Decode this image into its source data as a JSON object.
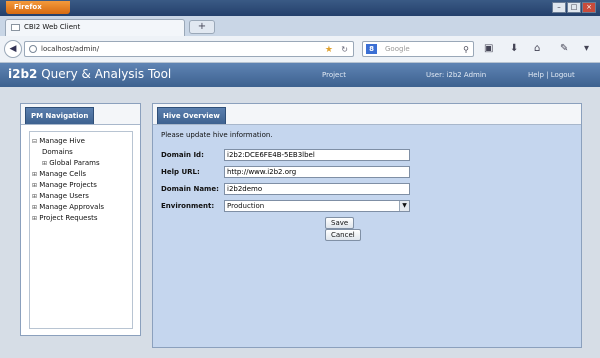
{
  "browser": {
    "menu_button": "Firefox",
    "tab_title": "CBI2 Web Client",
    "new_tab": "+",
    "url": "localhost/admin/",
    "search_placeholder": "Google",
    "search_engine_letter": "8"
  },
  "app": {
    "brand_prefix": "i2b2",
    "brand_title": "Query & Analysis Tool",
    "project_link": "Project",
    "user_label": "User: i2b2 Admin",
    "help_logout": "Help | Logout"
  },
  "nav": {
    "tab_label": "PM Navigation",
    "items": [
      {
        "label": "Manage Hive",
        "toggle": "⊟"
      },
      {
        "label": "Domains",
        "toggle": ""
      },
      {
        "label": "Global Params",
        "toggle": "⊞"
      },
      {
        "label": "Manage Cells",
        "toggle": "⊞"
      },
      {
        "label": "Manage Projects",
        "toggle": "⊞"
      },
      {
        "label": "Manage Users",
        "toggle": "⊞"
      },
      {
        "label": "Manage Approvals",
        "toggle": "⊞"
      },
      {
        "label": "Project Requests",
        "toggle": "⊞"
      }
    ]
  },
  "hive": {
    "tab_label": "Hive Overview",
    "message": "Please update hive information.",
    "fields": {
      "domain_id_label": "Domain Id:",
      "domain_id_value": "i2b2:DCE6FE4B-5EB3lbel",
      "help_url_label": "Help URL:",
      "help_url_value": "http://www.i2b2.org",
      "domain_name_label": "Domain Name:",
      "domain_name_value": "i2b2demo",
      "environment_label": "Environment:",
      "environment_value": "Production"
    },
    "save_button": "Save",
    "cancel_button": "Cancel"
  }
}
